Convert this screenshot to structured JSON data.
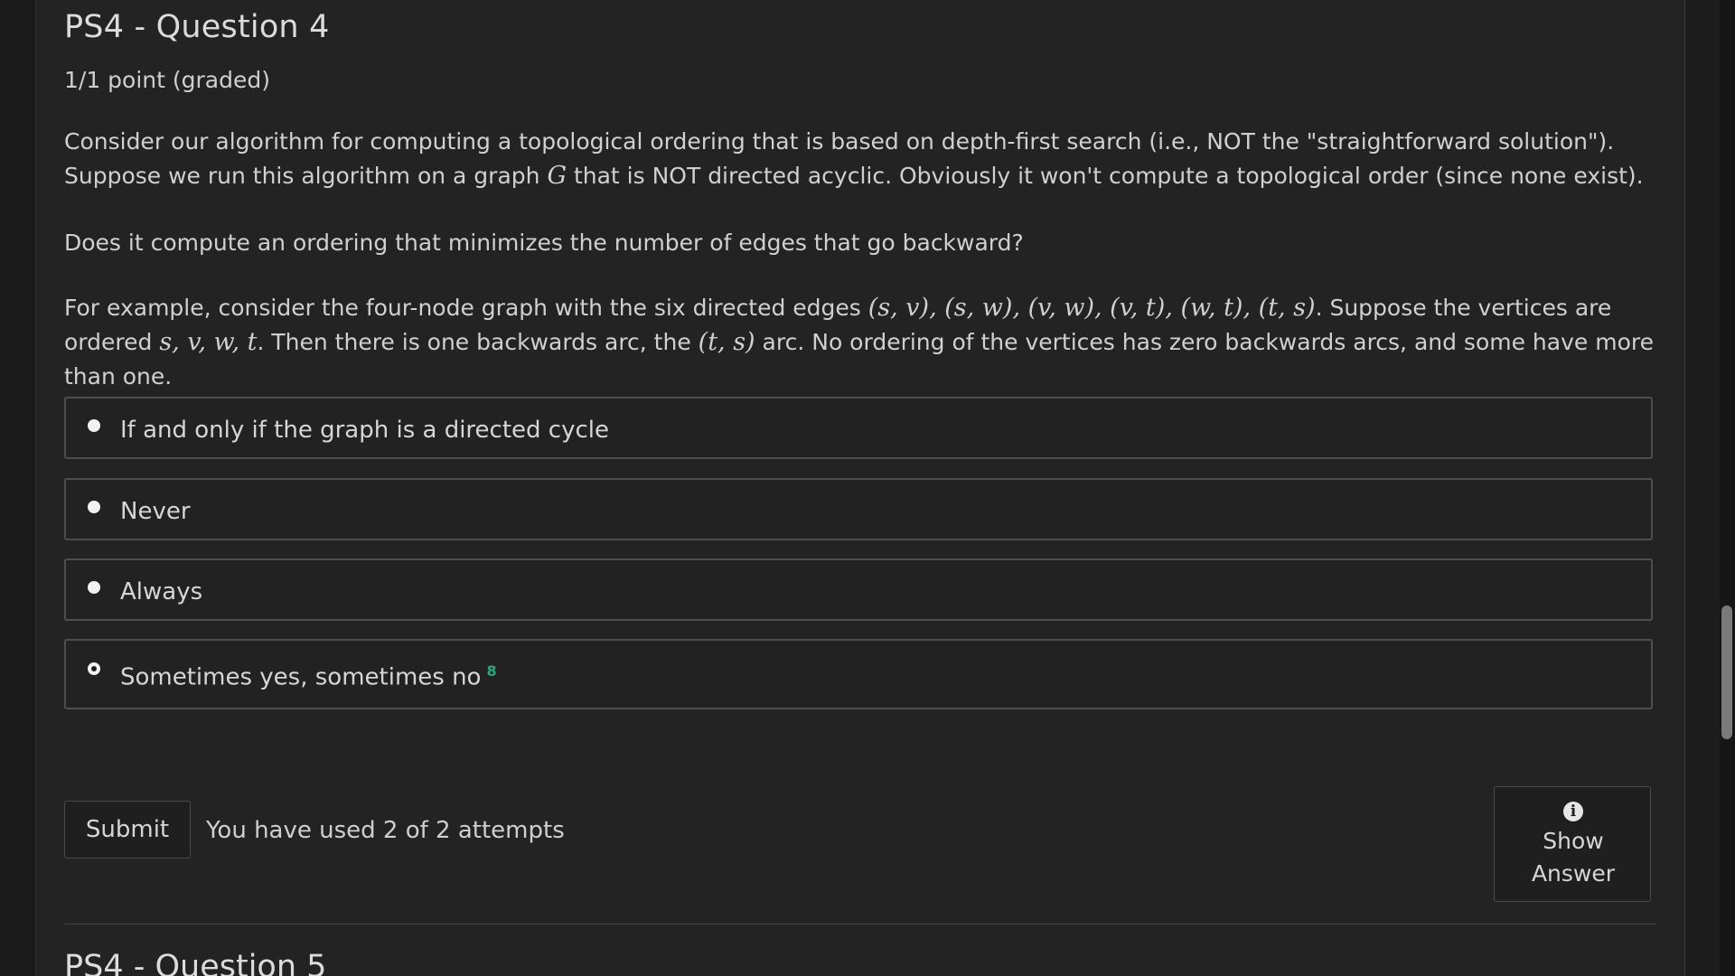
{
  "problem": {
    "title": "PS4 - Question 4",
    "score": "1/1 point (graded)",
    "paragraphs": {
      "p1": {
        "before": "Consider our algorithm for computing a topological ordering that is based on depth-first search (i.e., NOT the \"straightforward solution\"). Suppose we run this algorithm on a graph ",
        "math": "G",
        "after": " that is NOT directed acyclic. Obviously it won't compute a topological order (since none exist)."
      },
      "p2": "Does it compute an ordering that minimizes the number of edges that go backward?",
      "p3": {
        "part1": "For example, consider the four-node graph with the six directed edges ",
        "math1": "(s, v), (s, w), (v, w), (v, t), (w, t), (t, s)",
        "part2": ". Suppose the vertices are ordered ",
        "math2": "s, v, w, t",
        "part3": ". Then there is one backwards arc, the ",
        "math3": "(t, s)",
        "part4": " arc. No ordering of the vertices has zero backwards arcs, and some have more than one."
      }
    },
    "options": [
      {
        "label": "If and only if the graph is a directed cycle",
        "selected": false
      },
      {
        "label": "Never",
        "selected": false
      },
      {
        "label": "Always",
        "selected": false
      },
      {
        "label": "Sometimes yes, sometimes no",
        "selected": true,
        "status_mark": "8"
      }
    ],
    "submit_label": "Submit",
    "attempts_text": "You have used 2 of 2 attempts",
    "show_answer": {
      "line1": "Show",
      "line2": "Answer",
      "icon": "info-icon"
    }
  },
  "next_problem": {
    "title": "PS4 - Question 5"
  },
  "colors": {
    "background": "#1f1f1f",
    "panel": "#232323",
    "text": "#d4d4d4",
    "border": "#4e4e4e",
    "status_green": "#2fa77e"
  }
}
